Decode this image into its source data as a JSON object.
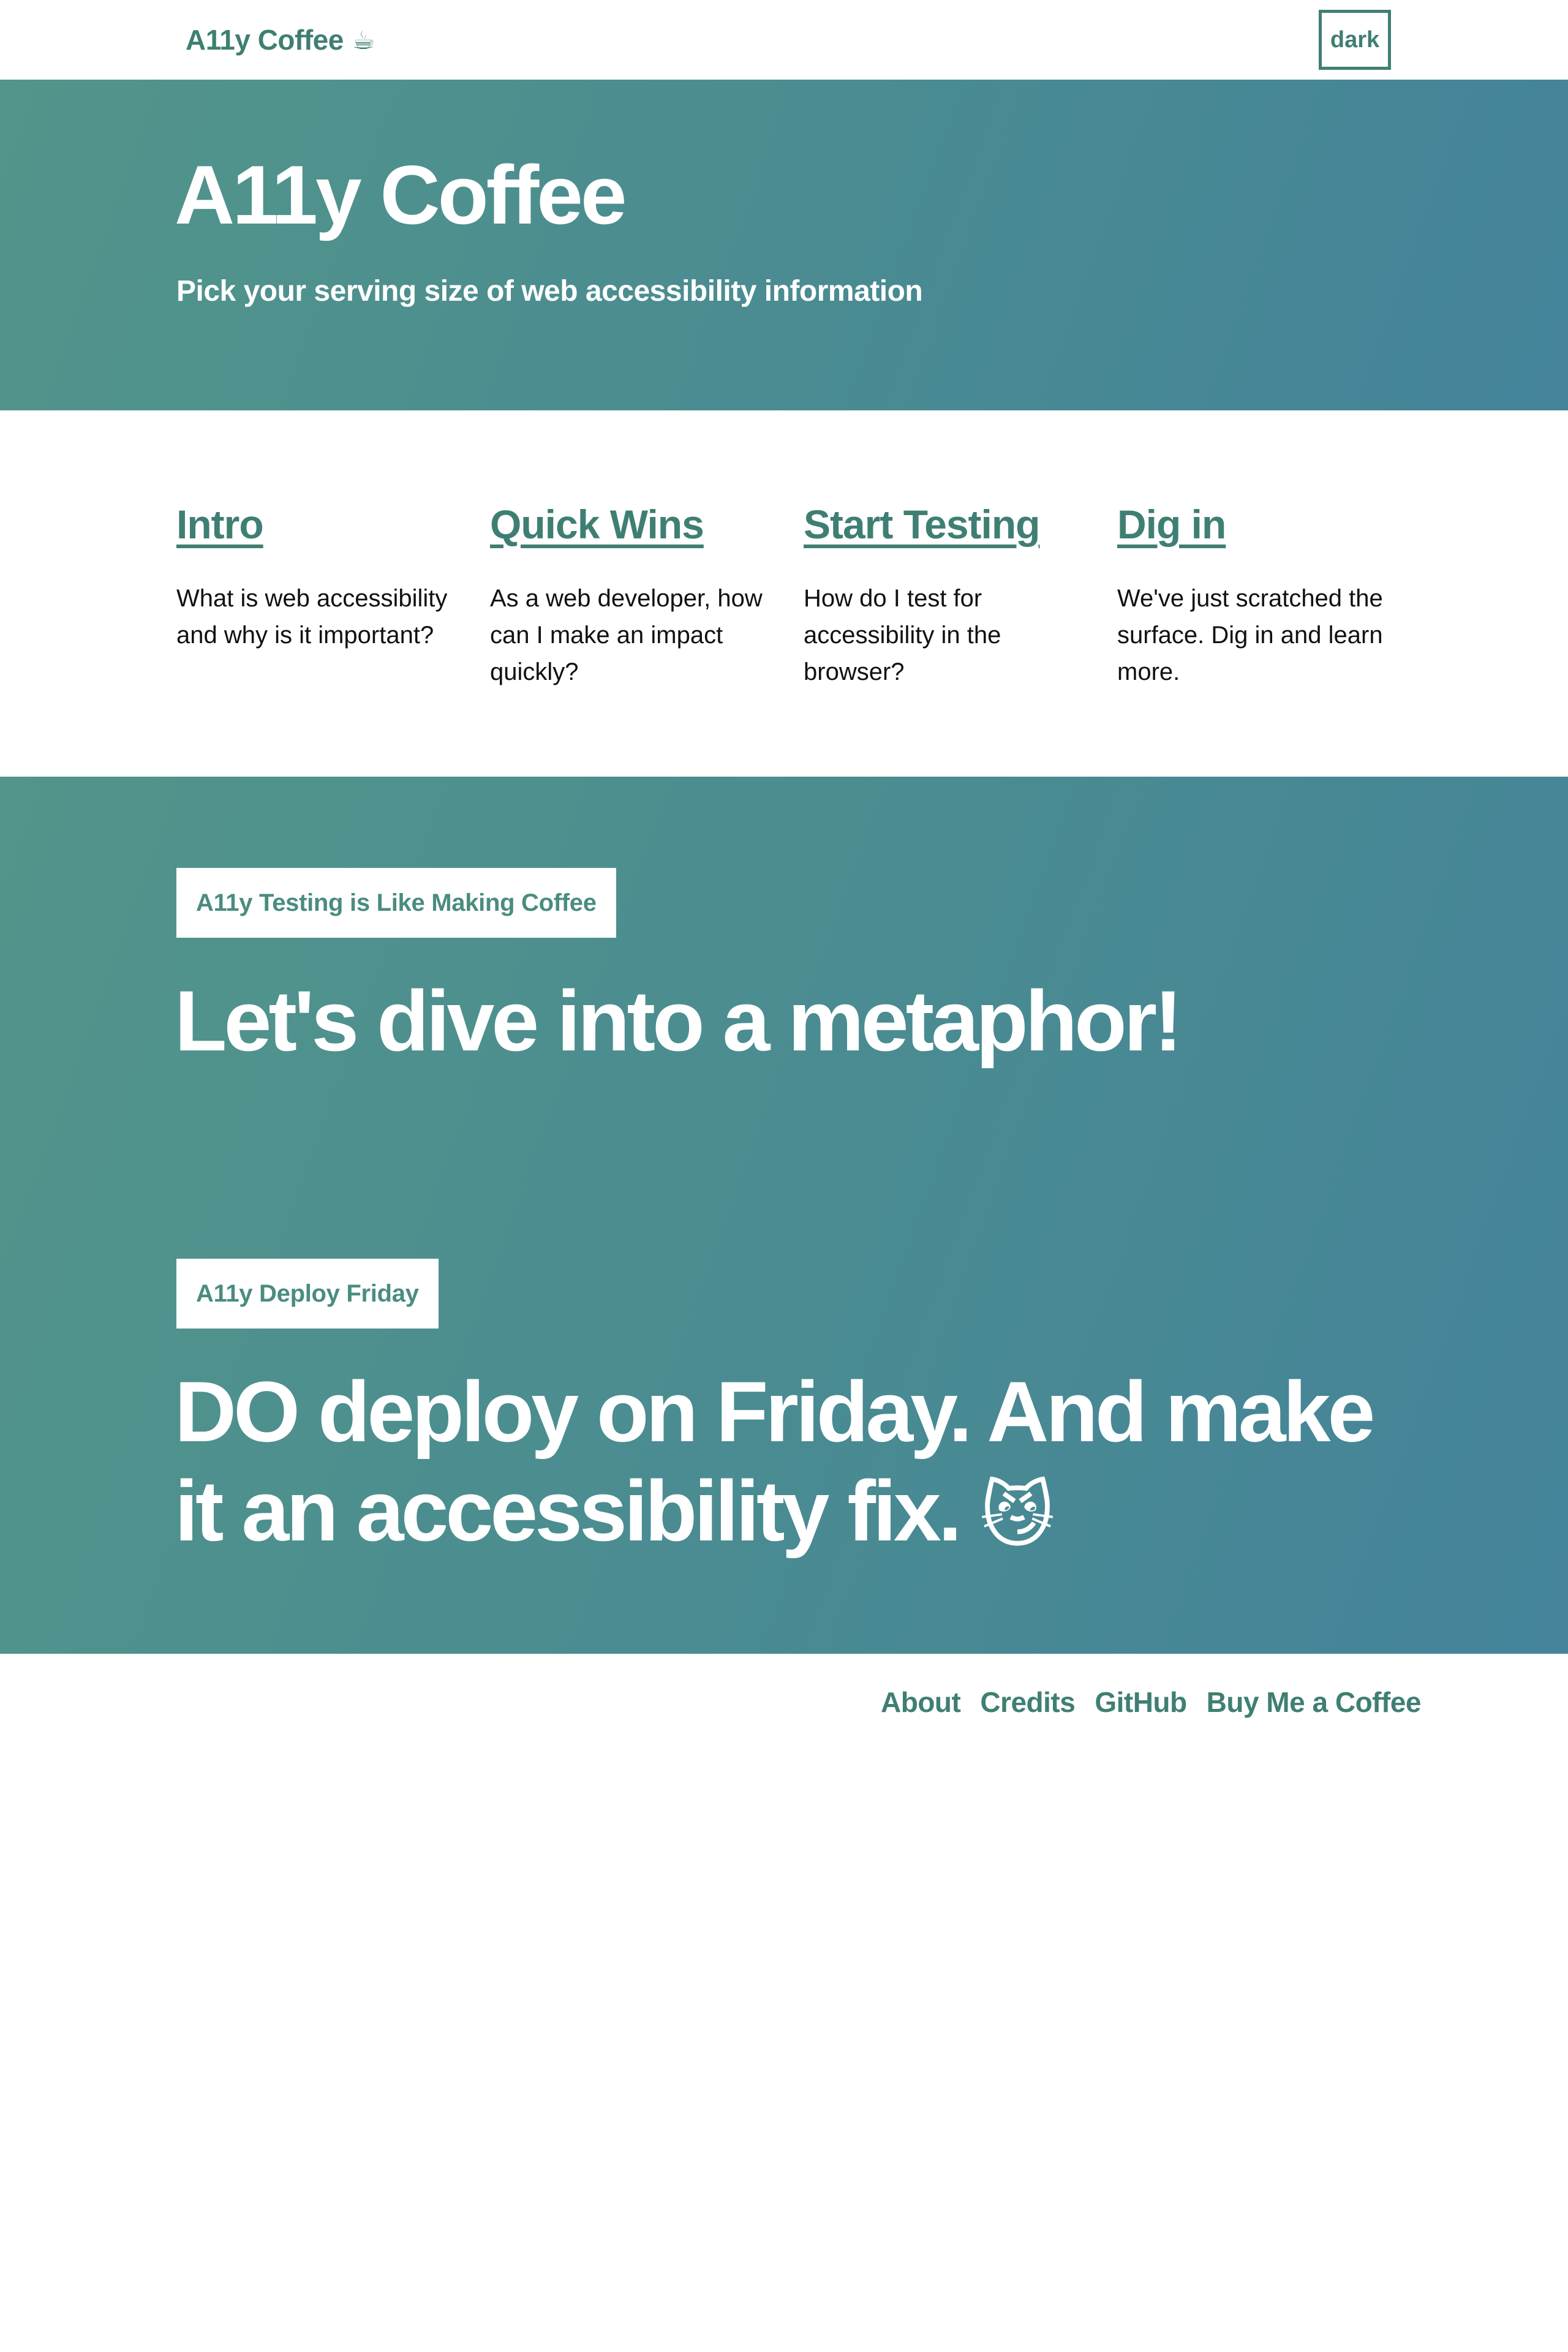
{
  "header": {
    "brand": "A11y Coffee",
    "brand_icon": "☕",
    "theme_toggle_label": "dark"
  },
  "hero": {
    "title": "A11y Coffee",
    "subtitle": "Pick your serving size of web accessibility information"
  },
  "servings": [
    {
      "label": "Intro",
      "description": "What is web accessibility and why is it important?"
    },
    {
      "label": "Quick Wins",
      "description": "As a web developer, how can I make an impact quickly?"
    },
    {
      "label": "Start Testing",
      "description": "How do I test for accessibility in the browser?"
    },
    {
      "label": "Dig in",
      "description": "We've just scratched the surface. Dig in and learn more."
    }
  ],
  "metaphor_1": {
    "tag": "A11y Testing is Like Making Coffee",
    "heading": "Let's dive into a metaphor!"
  },
  "metaphor_2": {
    "tag": "A11y Deploy Friday",
    "heading": "DO deploy on Friday. And make it an accessibility fix.",
    "emoji": "😼"
  },
  "footer": {
    "links": [
      "About",
      "Credits",
      "GitHub",
      "Buy Me a Coffee"
    ]
  },
  "colors": {
    "accent": "#3f7f73",
    "gradient_start": "#53958a",
    "gradient_end": "#44839a"
  }
}
